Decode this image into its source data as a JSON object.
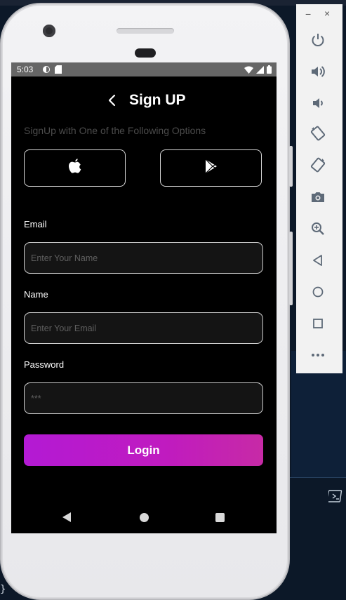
{
  "status_bar": {
    "time": "5:03"
  },
  "header": {
    "title": "Sign UP"
  },
  "subtitle": "SignUp with One of the Following Options",
  "form": {
    "email_label": "Email",
    "email_placeholder": "Enter Your Name",
    "name_label": "Name",
    "name_placeholder": "Enter Your Email",
    "password_label": "Password",
    "password_placeholder": "***"
  },
  "login_button": {
    "label": "Login"
  },
  "emulator_toolbar": {
    "minimize": "−",
    "close": "×",
    "icons": [
      "power-icon",
      "volume-up-icon",
      "volume-down-icon",
      "rotate-left-icon",
      "rotate-right-icon",
      "camera-icon",
      "zoom-icon",
      "back-icon",
      "home-icon",
      "overview-icon",
      "more-icon"
    ]
  },
  "desktop": {
    "brace": "}"
  },
  "colors": {
    "accent": "#b31ad4",
    "screen_bg": "#000000",
    "statusbar": "#666666"
  }
}
